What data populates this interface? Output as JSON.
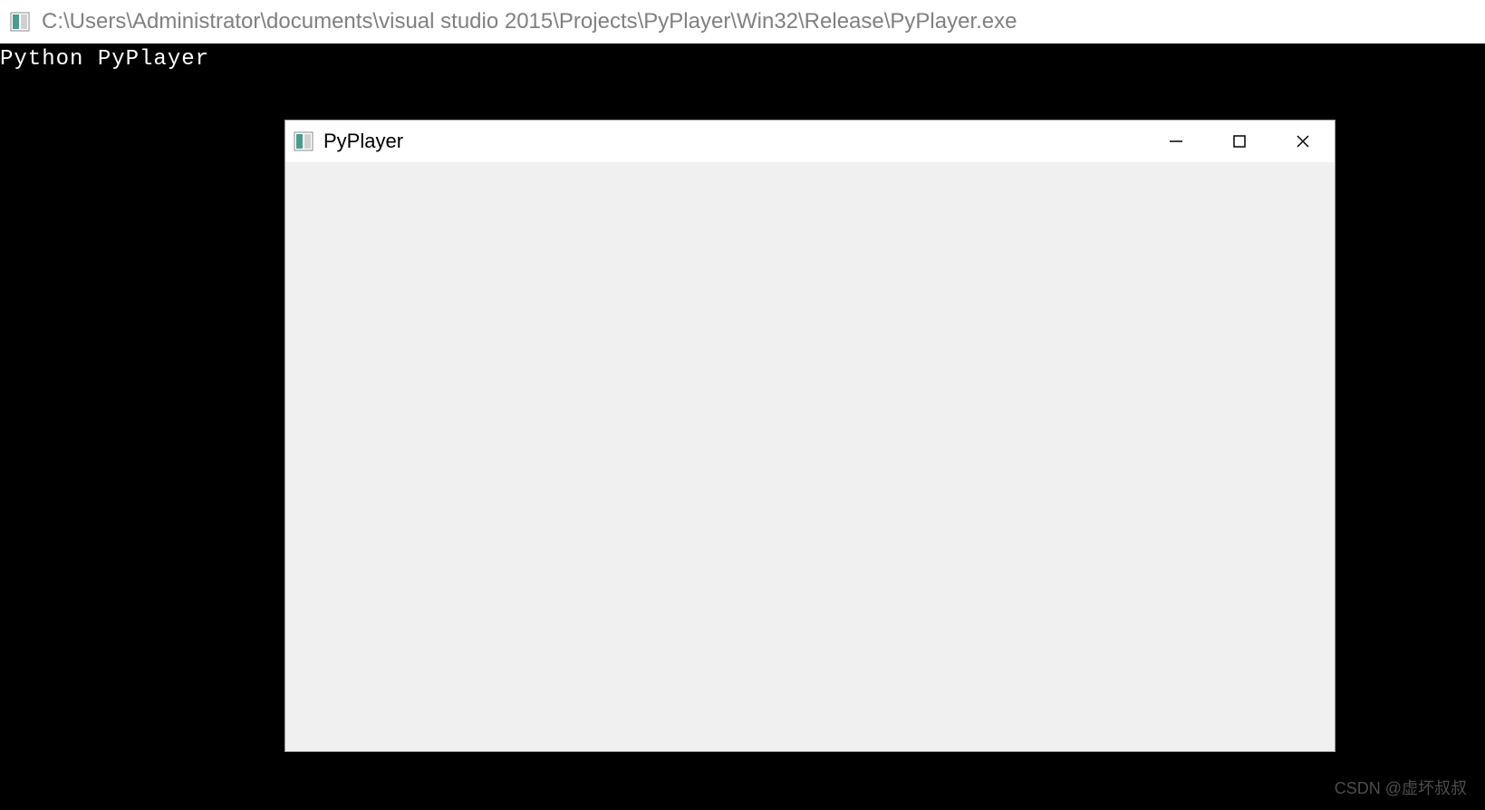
{
  "console": {
    "title": "C:\\Users\\Administrator\\documents\\visual studio 2015\\Projects\\PyPlayer\\Win32\\Release\\PyPlayer.exe",
    "output": "Python PyPlayer"
  },
  "app_window": {
    "title": "PyPlayer"
  },
  "watermark": "CSDN @虚坏叔叔"
}
